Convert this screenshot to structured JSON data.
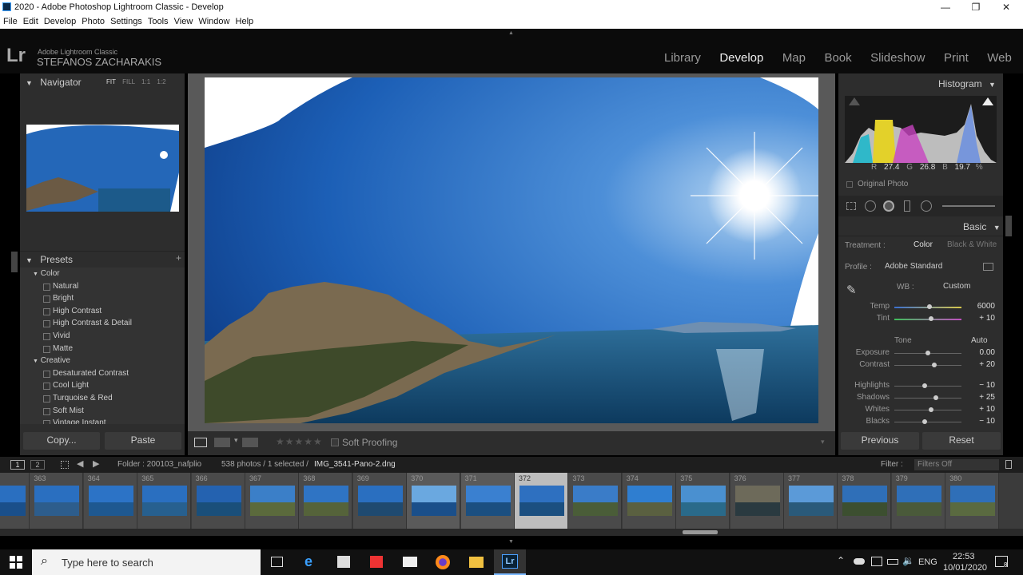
{
  "window": {
    "title": "2020 - Adobe Photoshop Lightroom Classic - Develop",
    "minimize": "—",
    "maximize": "❐",
    "close": "✕"
  },
  "menu": [
    "File",
    "Edit",
    "Develop",
    "Photo",
    "Settings",
    "Tools",
    "View",
    "Window",
    "Help"
  ],
  "identity": {
    "logo": "Lr",
    "app": "Adobe Lightroom Classic",
    "user": "STEFANOS ZACHARAKIS"
  },
  "modules": [
    {
      "label": "Library",
      "active": false
    },
    {
      "label": "Develop",
      "active": true
    },
    {
      "label": "Map",
      "active": false
    },
    {
      "label": "Book",
      "active": false
    },
    {
      "label": "Slideshow",
      "active": false
    },
    {
      "label": "Print",
      "active": false
    },
    {
      "label": "Web",
      "active": false
    }
  ],
  "navigator": {
    "title": "Navigator",
    "zoom": [
      "FIT",
      "FILL",
      "1:1",
      "1:2"
    ]
  },
  "presets": {
    "title": "Presets",
    "groups": [
      {
        "name": "Color",
        "items": [
          "Natural",
          "Bright",
          "High Contrast",
          "High Contrast & Detail",
          "Vivid",
          "Matte"
        ]
      },
      {
        "name": "Creative",
        "items": [
          "Desaturated Contrast",
          "Cool Light",
          "Turquoise & Red",
          "Soft Mist",
          "Vintage Instant"
        ]
      }
    ]
  },
  "left_buttons": {
    "copy": "Copy...",
    "paste": "Paste"
  },
  "toolbar": {
    "soft_proofing": "Soft Proofing",
    "stars": "★★★★★"
  },
  "histogram": {
    "title": "Histogram",
    "r_label": "R",
    "r": "27.4",
    "g_label": "G",
    "g": "26.8",
    "b_label": "B",
    "b": "19.7",
    "pct": "%",
    "original": "Original Photo"
  },
  "basic": {
    "title": "Basic",
    "treatment_label": "Treatment :",
    "treatment_color": "Color",
    "treatment_bw": "Black & White",
    "profile_label": "Profile :",
    "profile_value": "Adobe Standard",
    "wb_label": "WB :",
    "wb_value": "Custom",
    "tone_label": "Tone",
    "auto": "Auto",
    "sliders": [
      {
        "label": "Temp",
        "value": "6000",
        "pos": 0.52
      },
      {
        "label": "Tint",
        "value": "+ 10",
        "pos": 0.55
      },
      {
        "label": "Exposure",
        "value": "0.00",
        "pos": 0.5
      },
      {
        "label": "Contrast",
        "value": "+ 20",
        "pos": 0.6
      },
      {
        "label": "Highlights",
        "value": "− 10",
        "pos": 0.45
      },
      {
        "label": "Shadows",
        "value": "+ 25",
        "pos": 0.62
      },
      {
        "label": "Whites",
        "value": "+ 10",
        "pos": 0.55
      },
      {
        "label": "Blacks",
        "value": "− 10",
        "pos": 0.45
      }
    ]
  },
  "right_buttons": {
    "previous": "Previous",
    "reset": "Reset"
  },
  "filmbar": {
    "page1": "1",
    "page2": "2",
    "folder": "Folder : 200103_nafplio",
    "count": "538 photos / 1 selected /",
    "file": "IMG_3541-Pano-2.dng",
    "filter_label": "Filter :",
    "filter_value": "Filters Off"
  },
  "film_numbers": [
    "",
    "363",
    "364",
    "365",
    "366",
    "367",
    "368",
    "369",
    "370",
    "371",
    "372",
    "373",
    "374",
    "375",
    "376",
    "377",
    "378",
    "379",
    "380"
  ],
  "taskbar": {
    "search": "Type here to search",
    "lang": "ENG",
    "time": "22:53",
    "date": "10/01/2020",
    "notif": "8"
  }
}
